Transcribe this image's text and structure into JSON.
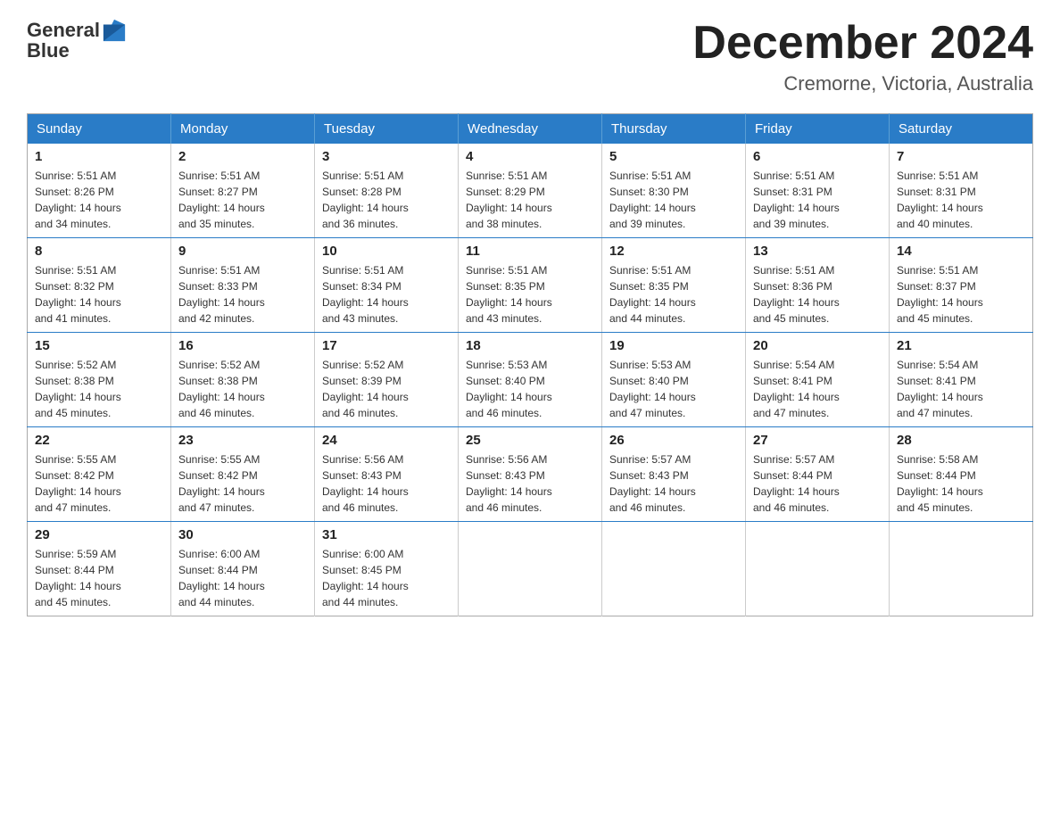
{
  "logo": {
    "text_general": "General",
    "text_blue": "Blue",
    "tagline": ""
  },
  "header": {
    "month_year": "December 2024",
    "location": "Cremorne, Victoria, Australia"
  },
  "days_of_week": [
    "Sunday",
    "Monday",
    "Tuesday",
    "Wednesday",
    "Thursday",
    "Friday",
    "Saturday"
  ],
  "weeks": [
    [
      {
        "day": "1",
        "sunrise": "5:51 AM",
        "sunset": "8:26 PM",
        "daylight": "14 hours and 34 minutes."
      },
      {
        "day": "2",
        "sunrise": "5:51 AM",
        "sunset": "8:27 PM",
        "daylight": "14 hours and 35 minutes."
      },
      {
        "day": "3",
        "sunrise": "5:51 AM",
        "sunset": "8:28 PM",
        "daylight": "14 hours and 36 minutes."
      },
      {
        "day": "4",
        "sunrise": "5:51 AM",
        "sunset": "8:29 PM",
        "daylight": "14 hours and 38 minutes."
      },
      {
        "day": "5",
        "sunrise": "5:51 AM",
        "sunset": "8:30 PM",
        "daylight": "14 hours and 39 minutes."
      },
      {
        "day": "6",
        "sunrise": "5:51 AM",
        "sunset": "8:31 PM",
        "daylight": "14 hours and 39 minutes."
      },
      {
        "day": "7",
        "sunrise": "5:51 AM",
        "sunset": "8:31 PM",
        "daylight": "14 hours and 40 minutes."
      }
    ],
    [
      {
        "day": "8",
        "sunrise": "5:51 AM",
        "sunset": "8:32 PM",
        "daylight": "14 hours and 41 minutes."
      },
      {
        "day": "9",
        "sunrise": "5:51 AM",
        "sunset": "8:33 PM",
        "daylight": "14 hours and 42 minutes."
      },
      {
        "day": "10",
        "sunrise": "5:51 AM",
        "sunset": "8:34 PM",
        "daylight": "14 hours and 43 minutes."
      },
      {
        "day": "11",
        "sunrise": "5:51 AM",
        "sunset": "8:35 PM",
        "daylight": "14 hours and 43 minutes."
      },
      {
        "day": "12",
        "sunrise": "5:51 AM",
        "sunset": "8:35 PM",
        "daylight": "14 hours and 44 minutes."
      },
      {
        "day": "13",
        "sunrise": "5:51 AM",
        "sunset": "8:36 PM",
        "daylight": "14 hours and 45 minutes."
      },
      {
        "day": "14",
        "sunrise": "5:51 AM",
        "sunset": "8:37 PM",
        "daylight": "14 hours and 45 minutes."
      }
    ],
    [
      {
        "day": "15",
        "sunrise": "5:52 AM",
        "sunset": "8:38 PM",
        "daylight": "14 hours and 45 minutes."
      },
      {
        "day": "16",
        "sunrise": "5:52 AM",
        "sunset": "8:38 PM",
        "daylight": "14 hours and 46 minutes."
      },
      {
        "day": "17",
        "sunrise": "5:52 AM",
        "sunset": "8:39 PM",
        "daylight": "14 hours and 46 minutes."
      },
      {
        "day": "18",
        "sunrise": "5:53 AM",
        "sunset": "8:40 PM",
        "daylight": "14 hours and 46 minutes."
      },
      {
        "day": "19",
        "sunrise": "5:53 AM",
        "sunset": "8:40 PM",
        "daylight": "14 hours and 47 minutes."
      },
      {
        "day": "20",
        "sunrise": "5:54 AM",
        "sunset": "8:41 PM",
        "daylight": "14 hours and 47 minutes."
      },
      {
        "day": "21",
        "sunrise": "5:54 AM",
        "sunset": "8:41 PM",
        "daylight": "14 hours and 47 minutes."
      }
    ],
    [
      {
        "day": "22",
        "sunrise": "5:55 AM",
        "sunset": "8:42 PM",
        "daylight": "14 hours and 47 minutes."
      },
      {
        "day": "23",
        "sunrise": "5:55 AM",
        "sunset": "8:42 PM",
        "daylight": "14 hours and 47 minutes."
      },
      {
        "day": "24",
        "sunrise": "5:56 AM",
        "sunset": "8:43 PM",
        "daylight": "14 hours and 46 minutes."
      },
      {
        "day": "25",
        "sunrise": "5:56 AM",
        "sunset": "8:43 PM",
        "daylight": "14 hours and 46 minutes."
      },
      {
        "day": "26",
        "sunrise": "5:57 AM",
        "sunset": "8:43 PM",
        "daylight": "14 hours and 46 minutes."
      },
      {
        "day": "27",
        "sunrise": "5:57 AM",
        "sunset": "8:44 PM",
        "daylight": "14 hours and 46 minutes."
      },
      {
        "day": "28",
        "sunrise": "5:58 AM",
        "sunset": "8:44 PM",
        "daylight": "14 hours and 45 minutes."
      }
    ],
    [
      {
        "day": "29",
        "sunrise": "5:59 AM",
        "sunset": "8:44 PM",
        "daylight": "14 hours and 45 minutes."
      },
      {
        "day": "30",
        "sunrise": "6:00 AM",
        "sunset": "8:44 PM",
        "daylight": "14 hours and 44 minutes."
      },
      {
        "day": "31",
        "sunrise": "6:00 AM",
        "sunset": "8:45 PM",
        "daylight": "14 hours and 44 minutes."
      },
      null,
      null,
      null,
      null
    ]
  ],
  "labels": {
    "sunrise": "Sunrise:",
    "sunset": "Sunset:",
    "daylight": "Daylight:"
  }
}
